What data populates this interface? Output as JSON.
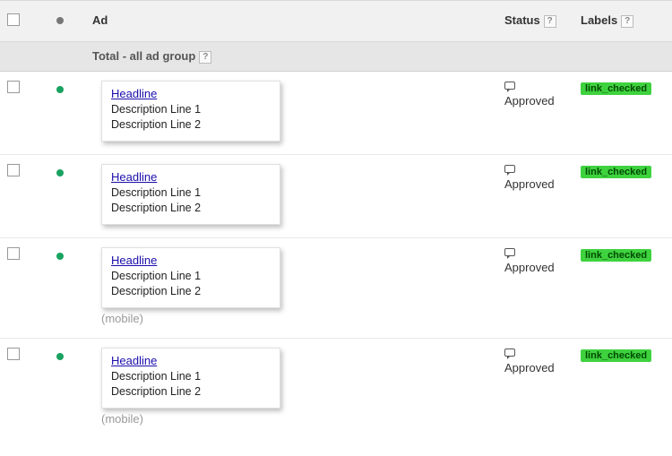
{
  "columns": {
    "ad": "Ad",
    "status": "Status",
    "labels": "Labels"
  },
  "summary": {
    "text": "Total - all ad group"
  },
  "help_glyph": "?",
  "rows": [
    {
      "dot_color": "green",
      "headline": "Headline",
      "desc1": "Description Line 1",
      "desc2": "Description Line 2",
      "mobile": "",
      "status": "Approved",
      "label": "link_checked"
    },
    {
      "dot_color": "green",
      "headline": "Headline",
      "desc1": "Description Line 1",
      "desc2": "Description Line 2",
      "mobile": "",
      "status": "Approved",
      "label": "link_checked"
    },
    {
      "dot_color": "green",
      "headline": "Headline",
      "desc1": "Description Line 1",
      "desc2": "Description Line 2",
      "mobile": "(mobile)",
      "status": "Approved",
      "label": "link_checked"
    },
    {
      "dot_color": "green",
      "headline": "Headline",
      "desc1": "Description Line 1",
      "desc2": "Description Line 2",
      "mobile": "(mobile)",
      "status": "Approved",
      "label": "link_checked"
    }
  ]
}
